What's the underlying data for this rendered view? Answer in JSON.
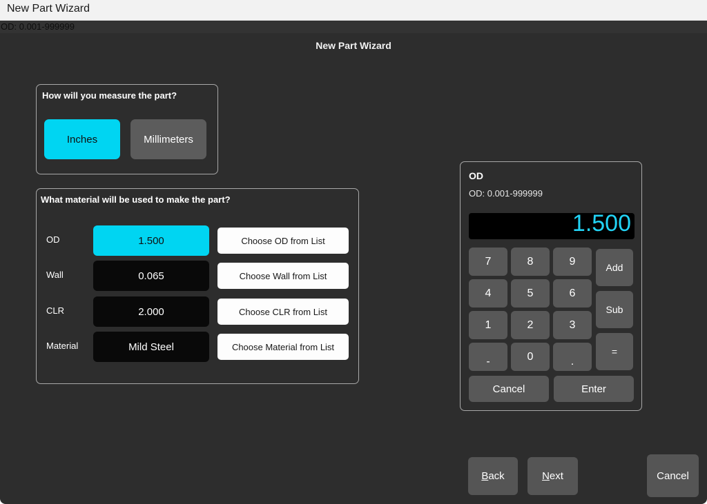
{
  "window": {
    "title": "New Part Wizard"
  },
  "status_strip": {
    "text": "OD: 0.001-999999"
  },
  "page": {
    "heading": "New Part Wizard"
  },
  "units_panel": {
    "title": "How will you measure the part?",
    "options": [
      {
        "label": "Inches",
        "selected": true
      },
      {
        "label": "Millimeters",
        "selected": false
      }
    ]
  },
  "material_panel": {
    "title": "What material will be used to make the part?",
    "rows": [
      {
        "label": "OD",
        "value": "1.500",
        "choose": "Choose OD from List",
        "selected": true
      },
      {
        "label": "Wall",
        "value": "0.065",
        "choose": "Choose Wall from List",
        "selected": false
      },
      {
        "label": "CLR",
        "value": "2.000",
        "choose": "Choose CLR from List",
        "selected": false
      },
      {
        "label": "Material",
        "value": "Mild Steel",
        "choose": "Choose Material from List",
        "selected": false
      }
    ]
  },
  "keypad": {
    "title": "OD",
    "range": "OD: 0.001-999999",
    "display_value": "1.500",
    "keys": {
      "k7": "7",
      "k8": "8",
      "k9": "9",
      "k4": "4",
      "k5": "5",
      "k6": "6",
      "k1": "1",
      "k2": "2",
      "k3": "3",
      "kminus": "-",
      "k0": "0",
      "kdot": ".",
      "add": "Add",
      "sub": "Sub",
      "equals": "=",
      "cancel": "Cancel",
      "enter": "Enter"
    }
  },
  "wizard_nav": {
    "back": {
      "accel": "B",
      "rest": "ack"
    },
    "next": {
      "accel": "N",
      "rest": "ext"
    },
    "cancel": "Cancel"
  },
  "colors": {
    "accent_cyan": "#00d5f2",
    "display_cyan": "#22d3f5",
    "window_background": "#2d2d2d",
    "titlebar_background": "#f2f2f2",
    "key_gray": "#585858",
    "field_black": "#090909",
    "choose_white": "#fdfdfd"
  }
}
